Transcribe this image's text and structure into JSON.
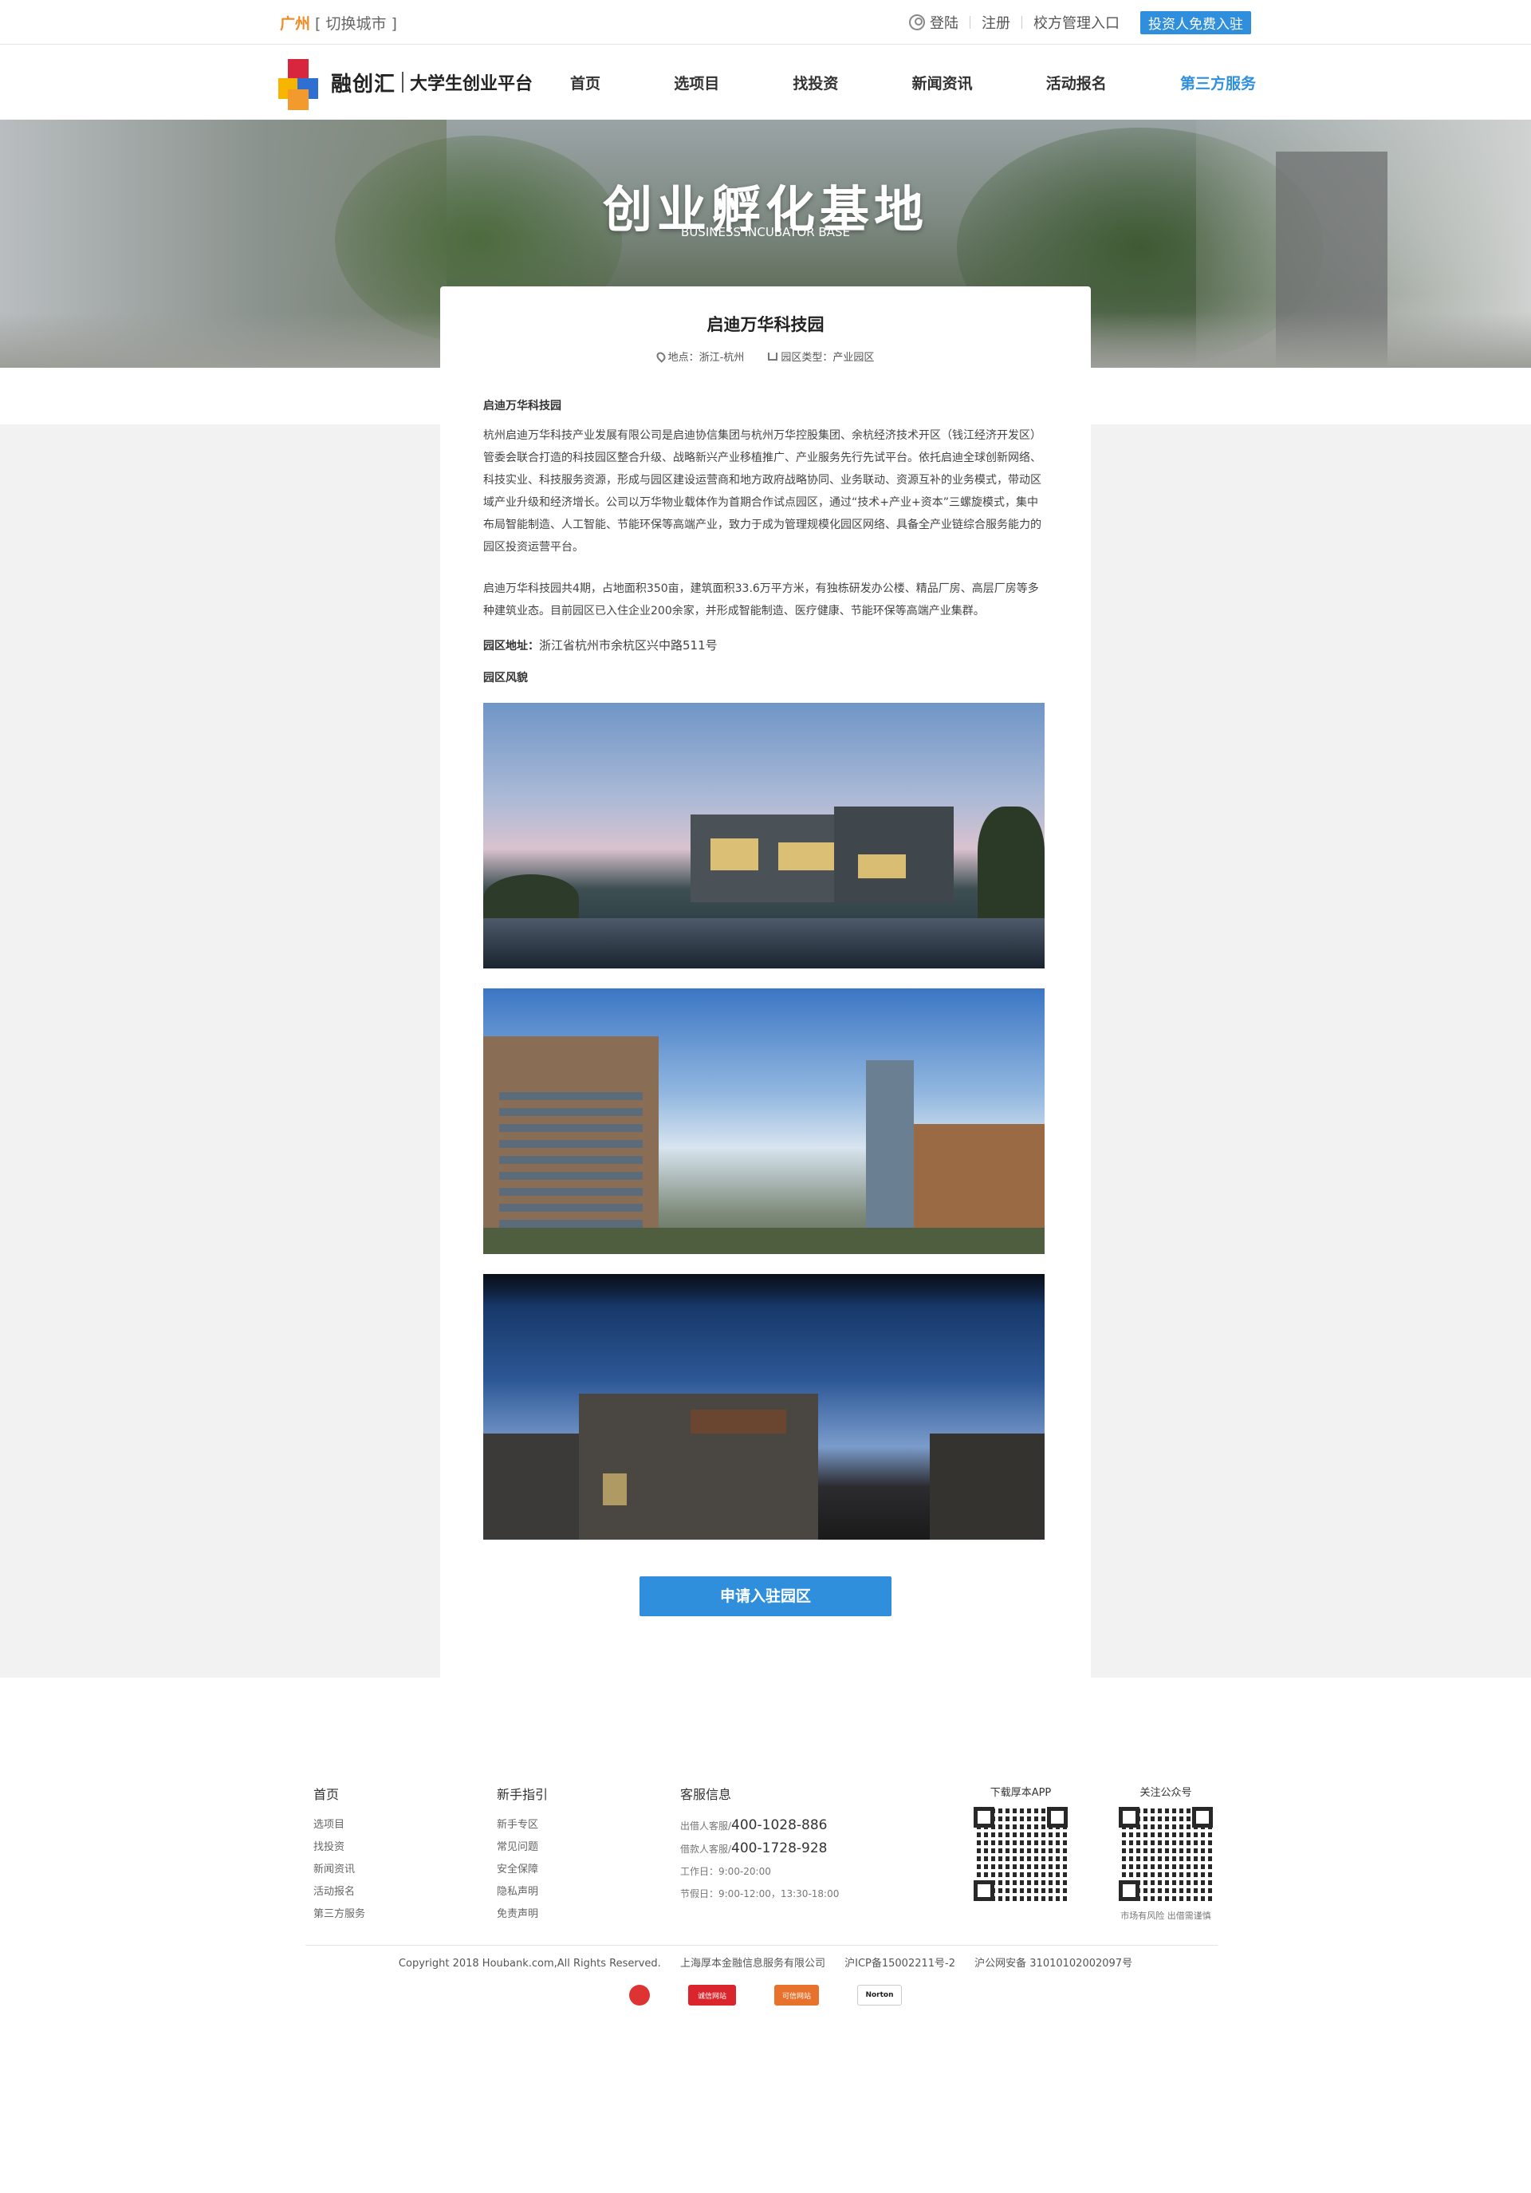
{
  "topbar": {
    "city": "广州",
    "switch_city": "[ 切换城市 ]",
    "login": "登陆",
    "register": "注册",
    "school_admin": "校方管理入口",
    "investor_join": "投资人免费入驻"
  },
  "logo": {
    "name": "融创汇",
    "subtitle": "大学生创业平台"
  },
  "nav": {
    "items": [
      "首页",
      "选项目",
      "找投资",
      "新闻资讯",
      "活动报名",
      "第三方服务"
    ]
  },
  "banner": {
    "title": "创业孵化基地",
    "subtitle": "BUSINESS INCUBATOR BASE"
  },
  "park": {
    "name": "启迪万华科技园",
    "location": "地点：浙江-杭州",
    "type": "园区类型：产业园区",
    "section_title": "启迪万华科技园",
    "intro": "杭州启迪万华科技产业发展有限公司是启迪协信集团与杭州万华控股集团、余杭经济技术开区（钱江经济开发区）管委会联合打造的科技园区整合升级、战略新兴产业移植推广、产业服务先行先试平台。依托启迪全球创新网络、科技实业、科技服务资源，形成与园区建设运营商和地方政府战略协同、业务联动、资源互补的业务模式，带动区域产业升级和经济增长。公司以万华物业载体作为首期合作试点园区，通过“技术+产业+资本”三螺旋模式，集中布局智能制造、人工智能、节能环保等高端产业，致力于成为管理规模化园区网络、具备全产业链综合服务能力的园区投资运营平台。",
    "detail": "启迪万华科技园共4期，占地面积350亩，建筑面积33.6万平方米，有独栋研发办公楼、精品厂房、高层厂房等多种建筑业态。目前园区已入住企业200余家，并形成智能制造、医疗健康、节能环保等高端产业集群。",
    "address_label": "园区地址：",
    "address": "浙江省杭州市余杭区兴中路511号",
    "scene_title": "园区风貌",
    "apply_button": "申请入驻园区"
  },
  "footer": {
    "col1": {
      "title": "首页",
      "links": [
        "选项目",
        "找投资",
        "新闻资讯",
        "活动报名",
        "第三方服务"
      ]
    },
    "col2": {
      "title": "新手指引",
      "links": [
        "新手专区",
        "常见问题",
        "安全保障",
        "隐私声明",
        "免责声明"
      ]
    },
    "service": {
      "title": "客服信息",
      "lender_label": "出借人客服/",
      "lender_phone": "400-1028-886",
      "borrower_label": "借款人客服/",
      "borrower_phone": "400-1728-928",
      "workday": "工作日：9:00-20:00",
      "holiday": "节假日：9:00-12:00，13:30-18:00"
    },
    "app_title": "下载厚本APP",
    "wechat_title": "关注公众号",
    "risk_note": "市场有风险 出借需谨慎",
    "copyright": "Copyright 2018 Houbank.com,All Rights Reserved.",
    "company": "上海厚本金融信息服务有限公司",
    "icp": "沪ICP备15002211号-2",
    "police": "沪公网安备 31010102002097号",
    "badges": [
      "诚信网站",
      "可信网站",
      "Norton"
    ]
  }
}
